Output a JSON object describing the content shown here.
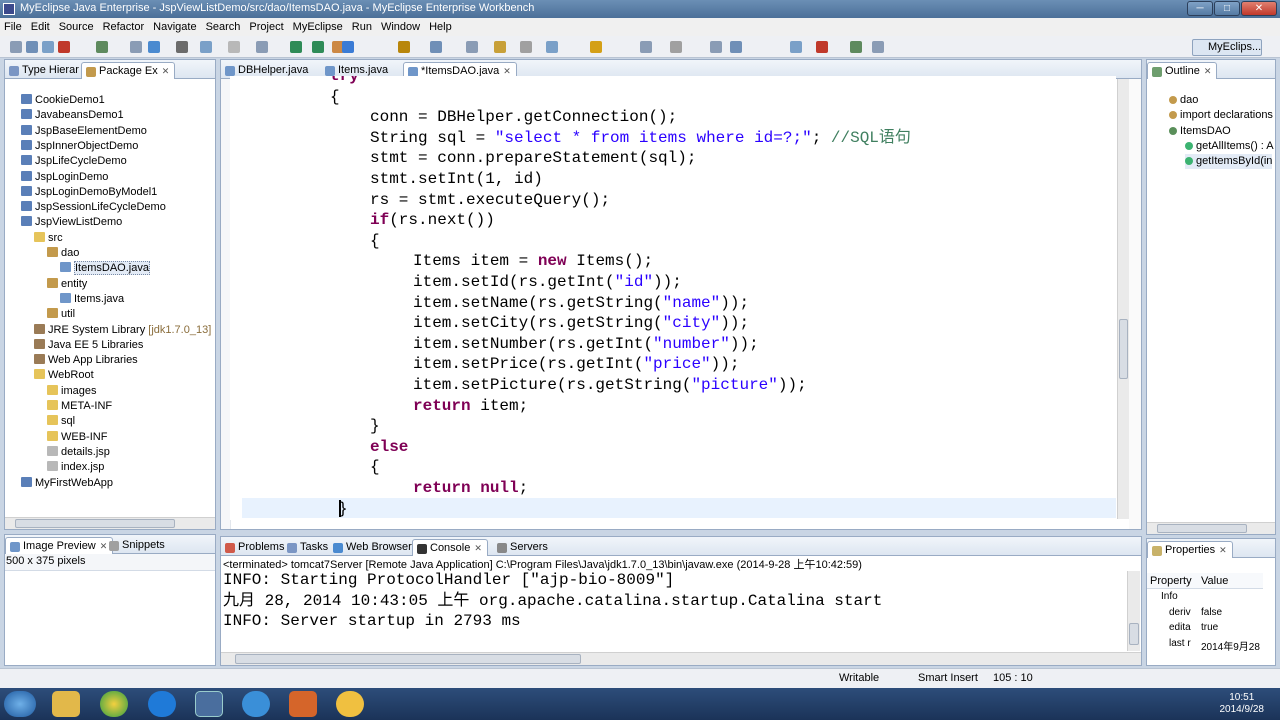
{
  "window": {
    "title": "MyEclipse Java Enterprise - JspViewListDemo/src/dao/ItemsDAO.java - MyEclipse Enterprise Workbench",
    "min": "─",
    "max": "□",
    "close": "✕"
  },
  "menu": [
    "File",
    "Edit",
    "Source",
    "Refactor",
    "Navigate",
    "Search",
    "Project",
    "MyEclipse",
    "Run",
    "Window",
    "Help"
  ],
  "perspective": "MyEclips...",
  "explorer": {
    "tabs": [
      "Type Hierar",
      "Package Ex"
    ],
    "tree": [
      {
        "label": "CookieDemo1",
        "depth": 0,
        "icon": "proj"
      },
      {
        "label": "JavabeansDemo1",
        "depth": 0,
        "icon": "proj"
      },
      {
        "label": "JspBaseElementDemo",
        "depth": 0,
        "icon": "proj"
      },
      {
        "label": "JspInnerObjectDemo",
        "depth": 0,
        "icon": "proj"
      },
      {
        "label": "JspLifeCycleDemo",
        "depth": 0,
        "icon": "proj"
      },
      {
        "label": "JspLoginDemo",
        "depth": 0,
        "icon": "proj"
      },
      {
        "label": "JspLoginDemoByModel1",
        "depth": 0,
        "icon": "proj"
      },
      {
        "label": "JspSessionLifeCycleDemo",
        "depth": 0,
        "icon": "proj"
      },
      {
        "label": "JspViewListDemo",
        "depth": 0,
        "icon": "proj"
      },
      {
        "label": "src",
        "depth": 1,
        "icon": "folder"
      },
      {
        "label": "dao",
        "depth": 2,
        "icon": "pkg"
      },
      {
        "label": "ItemsDAO.java",
        "depth": 3,
        "icon": "java"
      },
      {
        "label": "entity",
        "depth": 2,
        "icon": "pkg"
      },
      {
        "label": "Items.java",
        "depth": 3,
        "icon": "java"
      },
      {
        "label": "util",
        "depth": 2,
        "icon": "pkg"
      },
      {
        "label": "JRE System Library",
        "suffix": "[jdk1.7.0_13]",
        "depth": 1,
        "icon": "lib"
      },
      {
        "label": "Java EE 5 Libraries",
        "depth": 1,
        "icon": "lib"
      },
      {
        "label": "Web App Libraries",
        "depth": 1,
        "icon": "lib"
      },
      {
        "label": "WebRoot",
        "depth": 1,
        "icon": "folder"
      },
      {
        "label": "images",
        "depth": 2,
        "icon": "folder"
      },
      {
        "label": "META-INF",
        "depth": 2,
        "icon": "folder"
      },
      {
        "label": "sql",
        "depth": 2,
        "icon": "folder"
      },
      {
        "label": "WEB-INF",
        "depth": 2,
        "icon": "folder"
      },
      {
        "label": "details.jsp",
        "depth": 2,
        "icon": "file"
      },
      {
        "label": "index.jsp",
        "depth": 2,
        "icon": "file"
      },
      {
        "label": "MyFirstWebApp",
        "depth": 0,
        "icon": "proj"
      }
    ]
  },
  "preview": {
    "tabs": [
      "Image Preview",
      "Snippets"
    ],
    "size": "500 x 375 pixels"
  },
  "editor": {
    "tabs": [
      "DBHelper.java",
      "Items.java",
      "*ItemsDAO.java"
    ],
    "lines": [
      {
        "indent": 0,
        "parts": [
          {
            "t": "try",
            "c": "kw"
          }
        ]
      },
      {
        "indent": 0,
        "parts": [
          {
            "t": "{",
            "c": ""
          }
        ]
      },
      {
        "indent": 1,
        "parts": [
          {
            "t": "conn = DBHelper.getConnection();",
            "c": ""
          }
        ]
      },
      {
        "indent": 1,
        "parts": [
          {
            "t": "String sql = ",
            "c": ""
          },
          {
            "t": "\"select * from items where id=?;\"",
            "c": "str"
          },
          {
            "t": "; ",
            "c": ""
          },
          {
            "t": "//SQL语句",
            "c": "cmt"
          }
        ]
      },
      {
        "indent": 1,
        "parts": [
          {
            "t": "stmt = conn.prepareStatement(sql);",
            "c": ""
          }
        ]
      },
      {
        "indent": 1,
        "parts": [
          {
            "t": "stmt.setInt(1, id)",
            "c": ""
          }
        ]
      },
      {
        "indent": 1,
        "parts": [
          {
            "t": "rs = stmt.executeQuery();",
            "c": ""
          }
        ]
      },
      {
        "indent": 1,
        "parts": [
          {
            "t": "if",
            "c": "kw"
          },
          {
            "t": "(rs.next())",
            "c": ""
          }
        ]
      },
      {
        "indent": 1,
        "parts": [
          {
            "t": "{",
            "c": ""
          }
        ]
      },
      {
        "indent": 2,
        "parts": [
          {
            "t": "Items item = ",
            "c": ""
          },
          {
            "t": "new",
            "c": "kw"
          },
          {
            "t": " Items();",
            "c": ""
          }
        ]
      },
      {
        "indent": 2,
        "parts": [
          {
            "t": "item.setId(rs.getInt(",
            "c": ""
          },
          {
            "t": "\"id\"",
            "c": "str"
          },
          {
            "t": "));",
            "c": ""
          }
        ]
      },
      {
        "indent": 2,
        "parts": [
          {
            "t": "item.setName(rs.getString(",
            "c": ""
          },
          {
            "t": "\"name\"",
            "c": "str"
          },
          {
            "t": "));",
            "c": ""
          }
        ]
      },
      {
        "indent": 2,
        "parts": [
          {
            "t": "item.setCity(rs.getString(",
            "c": ""
          },
          {
            "t": "\"city\"",
            "c": "str"
          },
          {
            "t": "));",
            "c": ""
          }
        ]
      },
      {
        "indent": 2,
        "parts": [
          {
            "t": "item.setNumber(rs.getInt(",
            "c": ""
          },
          {
            "t": "\"number\"",
            "c": "str"
          },
          {
            "t": "));",
            "c": ""
          }
        ]
      },
      {
        "indent": 2,
        "parts": [
          {
            "t": "item.setPrice(rs.getInt(",
            "c": ""
          },
          {
            "t": "\"price\"",
            "c": "str"
          },
          {
            "t": "));",
            "c": ""
          }
        ]
      },
      {
        "indent": 2,
        "parts": [
          {
            "t": "item.setPicture(rs.getString(",
            "c": ""
          },
          {
            "t": "\"picture\"",
            "c": "str"
          },
          {
            "t": "));",
            "c": ""
          }
        ]
      },
      {
        "indent": 2,
        "parts": [
          {
            "t": "return",
            "c": "kw"
          },
          {
            "t": " item;",
            "c": ""
          }
        ]
      },
      {
        "indent": 1,
        "parts": [
          {
            "t": "}",
            "c": ""
          }
        ]
      },
      {
        "indent": 1,
        "parts": [
          {
            "t": "else",
            "c": "kw"
          }
        ]
      },
      {
        "indent": 1,
        "parts": [
          {
            "t": "{",
            "c": ""
          }
        ]
      },
      {
        "indent": 2,
        "parts": [
          {
            "t": "return",
            "c": "kw"
          },
          {
            "t": " ",
            "c": ""
          },
          {
            "t": "null",
            "c": "kw"
          },
          {
            "t": ";",
            "c": ""
          }
        ]
      },
      {
        "indent": 0,
        "parts": [
          {
            "t": "}",
            "c": ""
          }
        ]
      }
    ]
  },
  "outline": {
    "tab": "Outline",
    "items": [
      {
        "label": "dao",
        "depth": 0
      },
      {
        "label": "import declarations",
        "depth": 0
      },
      {
        "label": "ItemsDAO",
        "depth": 0
      },
      {
        "label": "getAllItems() : A",
        "depth": 1
      },
      {
        "label": "getItemsById(in",
        "depth": 1
      }
    ]
  },
  "console": {
    "tabs": [
      "Problems",
      "Tasks",
      "Web Browser",
      "Console",
      "Servers"
    ],
    "header": "<terminated> tomcat7Server [Remote Java Application] C:\\Program Files\\Java\\jdk1.7.0_13\\bin\\javaw.exe (2014-9-28 上午10:42:59)",
    "lines": [
      "INFO: Starting ProtocolHandler [\"ajp-bio-8009\"]",
      "九月 28, 2014 10:43:05 上午 org.apache.catalina.startup.Catalina start",
      "INFO: Server startup in 2793 ms"
    ]
  },
  "properties": {
    "tab": "Properties",
    "col_property": "Property",
    "col_value": "Value",
    "rows": [
      {
        "k": "Info",
        "v": ""
      },
      {
        "k": "deriv",
        "v": "false"
      },
      {
        "k": "edita",
        "v": "true"
      },
      {
        "k": "last r",
        "v": "2014年9月28"
      }
    ]
  },
  "status": {
    "writable": "Writable",
    "insert": "Smart Insert",
    "position": "105 : 10"
  },
  "taskbar": {
    "time": "10:51",
    "date": "2014/9/28"
  }
}
